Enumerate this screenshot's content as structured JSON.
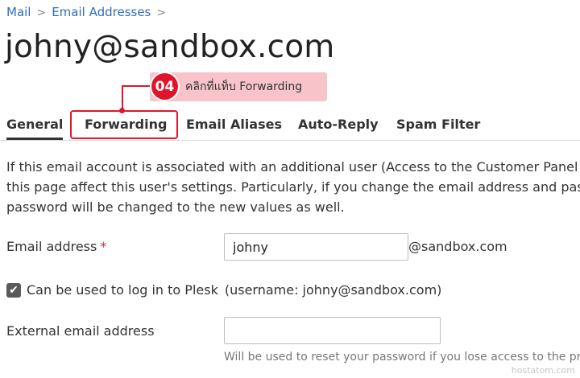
{
  "breadcrumb": {
    "items": [
      "Mail",
      "Email Addresses"
    ],
    "separator": ">"
  },
  "page_title": "johny@sandbox.com",
  "callout": {
    "step": "04",
    "text": "คลิกที่แท็บ Forwarding"
  },
  "tabs": [
    {
      "label": "General",
      "active": true
    },
    {
      "label": "Forwarding",
      "active": false,
      "highlighted": true
    },
    {
      "label": "Email Aliases",
      "active": false
    },
    {
      "label": "Auto-Reply",
      "active": false
    },
    {
      "label": "Spam Filter",
      "active": false
    }
  ],
  "intro_text": "If this email account is associated with an additional user (Access to the Customer Panel\nthis page affect this user's settings. Particularly, if you change the email address and pas\npassword will be changed to the new values as well.",
  "form": {
    "email_address": {
      "label": "Email address",
      "required_mark": "*",
      "value": "johny",
      "suffix": "@sandbox.com"
    },
    "login_checkbox": {
      "label": "Can be used to log in to Plesk",
      "hint": "(username: johny@sandbox.com)",
      "checked": true
    },
    "external_email": {
      "label": "External email address",
      "value": "",
      "help": "Will be used to reset your password if you lose access to the pri"
    }
  },
  "watermark": "hostatom.com",
  "colors": {
    "link": "#2f6fb5",
    "accent_red": "#e0152b",
    "callout_bg": "#f8c3c9",
    "required": "#d9292e"
  },
  "icons": {
    "breadcrumb_separator": "chevron-right-icon",
    "checkbox": "checkmark-icon"
  }
}
